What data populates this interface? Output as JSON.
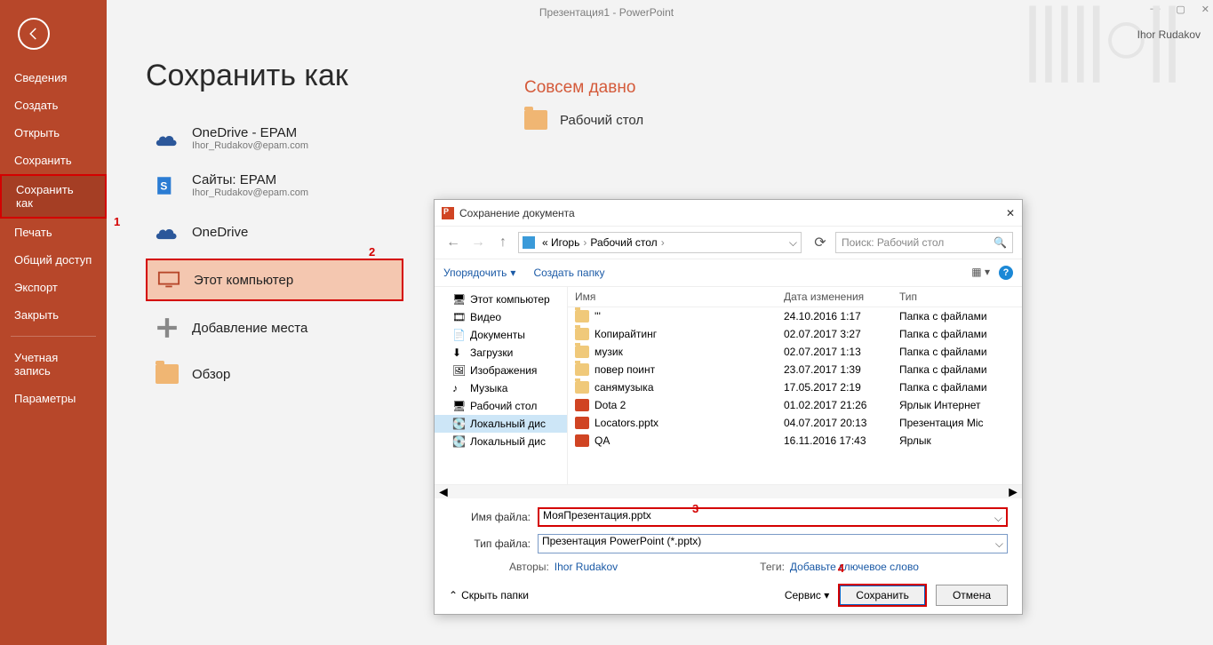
{
  "window": {
    "title": "Презентация1 - PowerPoint",
    "user": "Ihor Rudakov"
  },
  "sidebar": {
    "items": [
      {
        "label": "Сведения"
      },
      {
        "label": "Создать"
      },
      {
        "label": "Открыть"
      },
      {
        "label": "Сохранить"
      },
      {
        "label": "Сохранить как",
        "selected": true
      },
      {
        "label": "Печать"
      },
      {
        "label": "Общий доступ"
      },
      {
        "label": "Экспорт"
      },
      {
        "label": "Закрыть"
      }
    ],
    "bottom": [
      {
        "label": "Учетная\nзапись"
      },
      {
        "label": "Параметры"
      }
    ]
  },
  "page": {
    "title": "Сохранить как",
    "locations": [
      {
        "title": "OneDrive - EPAM",
        "sub": "Ihor_Rudakov@epam.com",
        "icon": "cloud"
      },
      {
        "title": "Сайты: EPAM",
        "sub": "Ihor_Rudakov@epam.com",
        "icon": "sharepoint"
      },
      {
        "title": "OneDrive",
        "icon": "cloud"
      },
      {
        "title": "Этот компьютер",
        "icon": "computer",
        "selected": true
      },
      {
        "title": "Добавление места",
        "icon": "plus"
      },
      {
        "title": "Обзор",
        "icon": "folder"
      }
    ],
    "right": {
      "heading": "Совсем давно",
      "folder": "Рабочий стол"
    }
  },
  "annotations": {
    "a1": "1",
    "a2": "2",
    "a3": "3",
    "a4": "4"
  },
  "dialog": {
    "title": "Сохранение документа",
    "path": {
      "prefix": "« Игорь",
      "segments": [
        "Рабочий стол"
      ]
    },
    "search_placeholder": "Поиск: Рабочий стол",
    "toolbar": {
      "organize": "Упорядочить",
      "newfolder": "Создать папку"
    },
    "tree": [
      {
        "label": "Этот компьютер",
        "icon": "pc"
      },
      {
        "label": "Видео",
        "icon": "video"
      },
      {
        "label": "Документы",
        "icon": "docs"
      },
      {
        "label": "Загрузки",
        "icon": "down"
      },
      {
        "label": "Изображения",
        "icon": "img"
      },
      {
        "label": "Музыка",
        "icon": "music"
      },
      {
        "label": "Рабочий стол",
        "icon": "desk"
      },
      {
        "label": "Локальный дис",
        "icon": "disk",
        "sel": true
      },
      {
        "label": "Локальный дис",
        "icon": "disk"
      }
    ],
    "columns": {
      "name": "Имя",
      "date": "Дата изменения",
      "type": "Тип"
    },
    "files": [
      {
        "name": "'''",
        "date": "24.10.2016 1:17",
        "type": "Папка с файлами",
        "icon": "folder"
      },
      {
        "name": "Копирайтинг",
        "date": "02.07.2017 3:27",
        "type": "Папка с файлами",
        "icon": "folder"
      },
      {
        "name": "музик",
        "date": "02.07.2017 1:13",
        "type": "Папка с файлами",
        "icon": "folder"
      },
      {
        "name": "повер поинт",
        "date": "23.07.2017 1:39",
        "type": "Папка с файлами",
        "icon": "folder"
      },
      {
        "name": "санямузыка",
        "date": "17.05.2017 2:19",
        "type": "Папка с файлами",
        "icon": "folder"
      },
      {
        "name": "Dota 2",
        "date": "01.02.2017 21:26",
        "type": "Ярлык Интернет",
        "icon": "short"
      },
      {
        "name": "Locators.pptx",
        "date": "04.07.2017 20:13",
        "type": "Презентация Mic",
        "icon": "pp"
      },
      {
        "name": "QA",
        "date": "16.11.2016 17:43",
        "type": "Ярлык",
        "icon": "short"
      }
    ],
    "fields": {
      "filename_label": "Имя файла:",
      "filename": "МояПрезентация.pptx",
      "filetype_label": "Тип файла:",
      "filetype": "Презентация PowerPoint (*.pptx)",
      "authors_label": "Авторы:",
      "authors": "Ihor Rudakov",
      "tags_label": "Теги:",
      "tags": "Добавьте ключевое слово"
    },
    "footer": {
      "hide": "Скрыть папки",
      "service": "Сервис",
      "save": "Сохранить",
      "cancel": "Отмена"
    }
  }
}
